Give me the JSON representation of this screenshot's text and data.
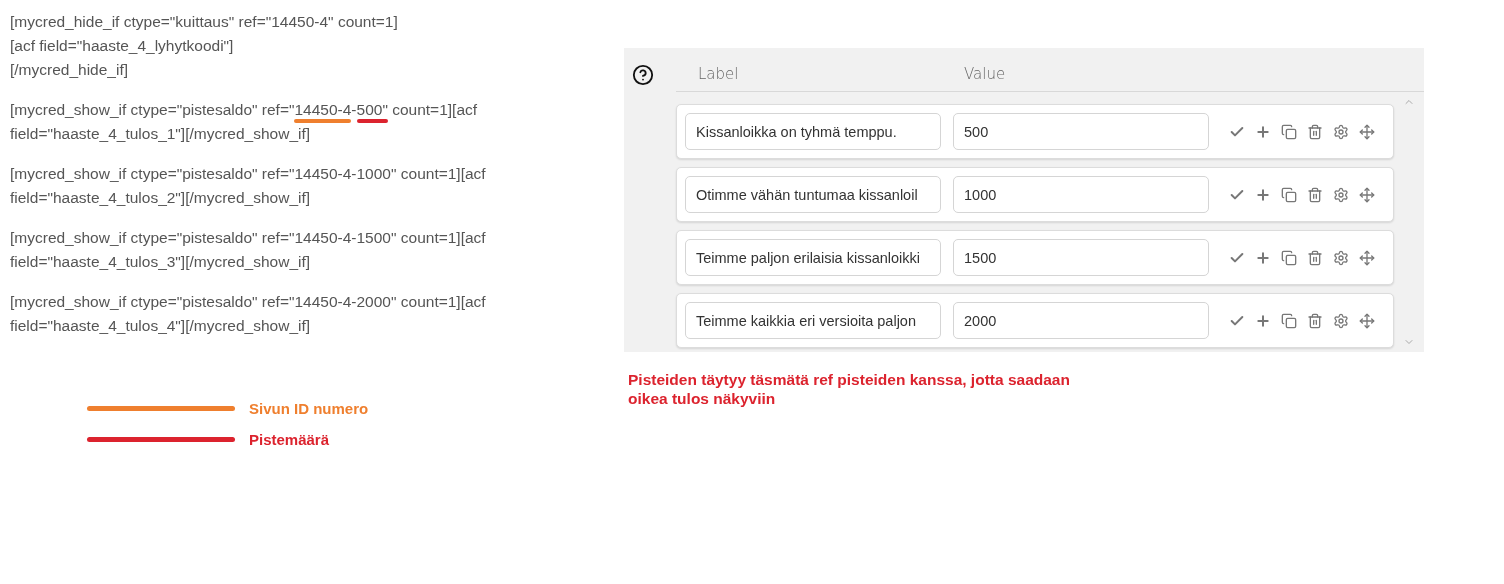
{
  "code_paragraphs": [
    {
      "lines": [
        [
          {
            "text": "[mycred_hide_if ctype=\"kuittaus\" ref=\"14450-4\" count=1]"
          }
        ],
        [
          {
            "text": "[acf field=\"haaste_4_lyhytkoodi\"]"
          }
        ],
        [
          {
            "text": "[/mycred_hide_if]"
          }
        ]
      ]
    },
    {
      "lines": [
        [
          {
            "text": "[mycred_show_if ctype=\"pistesaldo\" ref=\""
          },
          {
            "text": "14450-4",
            "color": "#ef7f2e"
          },
          {
            "text": "-"
          },
          {
            "text": "500\"",
            "color": "#dc232e"
          },
          {
            "text": " count=1][acf"
          }
        ],
        [
          {
            "text": "field=\"haaste_4_tulos_1\"][/mycred_show_if]"
          }
        ]
      ]
    },
    {
      "lines": [
        [
          {
            "text": "[mycred_show_if ctype=\"pistesaldo\" ref=\"14450-4-1000\" count=1][acf"
          }
        ],
        [
          {
            "text": "field=\"haaste_4_tulos_2\"][/mycred_show_if]"
          }
        ]
      ]
    },
    {
      "lines": [
        [
          {
            "text": "[mycred_show_if ctype=\"pistesaldo\" ref=\"14450-4-1500\" count=1][acf"
          }
        ],
        [
          {
            "text": "field=\"haaste_4_tulos_3\"][/mycred_show_if]"
          }
        ]
      ]
    },
    {
      "lines": [
        [
          {
            "text": "[mycred_show_if ctype=\"pistesaldo\" ref=\"14450-4-2000\" count=1][acf"
          }
        ],
        [
          {
            "text": "field=\"haaste_4_tulos_4\"][/mycred_show_if]"
          }
        ]
      ]
    }
  ],
  "legend": [
    {
      "label": "Sivun ID numero",
      "color": "#ef7f2e"
    },
    {
      "label": "Pistemäärä",
      "color": "#dc232e"
    }
  ],
  "panel": {
    "columns": [
      "Label",
      "Value"
    ],
    "rows": [
      {
        "label": "Kissanloikka on tyhmä temppu.",
        "value": "500"
      },
      {
        "label": "Otimme vähän tuntumaa kissanloil",
        "value": "1000"
      },
      {
        "label": "Teimme paljon erilaisia kissanloikki",
        "value": "1500"
      },
      {
        "label": "Teimme kaikkia eri versioita paljon",
        "value": "2000"
      }
    ]
  },
  "note": [
    "Pisteiden täytyy täsmätä ref pisteiden kanssa, jotta saadaan",
    "oikea tulos näkyviin"
  ]
}
